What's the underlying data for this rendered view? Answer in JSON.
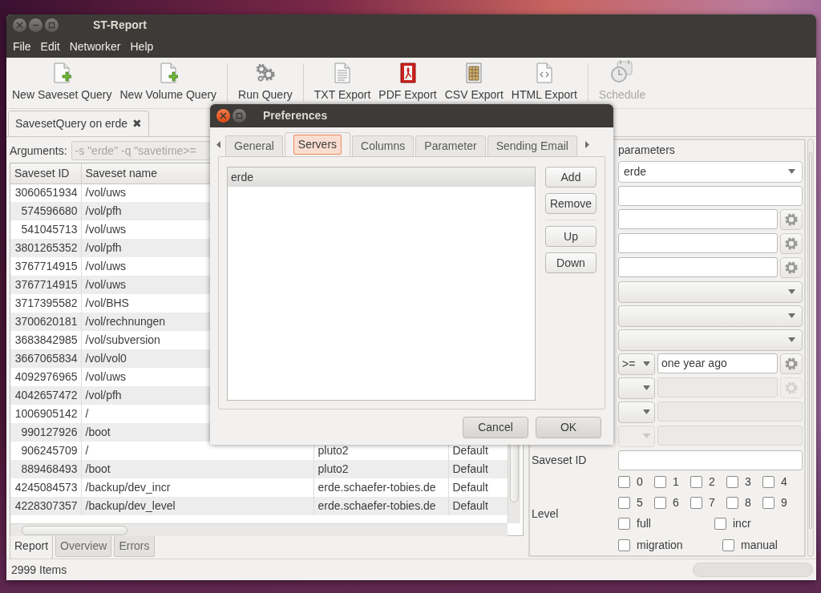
{
  "window": {
    "title": "ST-Report"
  },
  "menu": [
    "File",
    "Edit",
    "Networker",
    "Help"
  ],
  "toolbar_groups": [
    {
      "buttons": [
        {
          "label": "New Saveset Query",
          "disabled": false
        },
        {
          "label": "New Volume Query",
          "disabled": false
        }
      ]
    },
    {
      "buttons": [
        {
          "label": "Run Query",
          "disabled": false
        }
      ]
    },
    {
      "buttons": [
        {
          "label": "TXT Export",
          "disabled": false
        },
        {
          "label": "PDF Export",
          "disabled": false
        },
        {
          "label": "CSV Export",
          "disabled": false
        },
        {
          "label": "HTML Export",
          "disabled": false
        }
      ]
    },
    {
      "buttons": [
        {
          "label": "Schedule",
          "disabled": true
        }
      ]
    }
  ],
  "document_tabs": [
    {
      "label": "SavesetQuery on erde",
      "close": "✖",
      "selected": true
    }
  ],
  "arguments": {
    "label": "Arguments:",
    "value": "-s \"erde\" -q \"savetime>=",
    "disabled": true
  },
  "table": {
    "columns": [
      "Saveset ID",
      "Saveset name"
    ],
    "rows": [
      {
        "cells": [
          "3060651934",
          "/vol/uws"
        ]
      },
      {
        "cells": [
          "574596680",
          "/vol/pfh"
        ]
      },
      {
        "cells": [
          "541045713",
          "/vol/uws"
        ]
      },
      {
        "cells": [
          "3801265352",
          "/vol/pfh"
        ]
      },
      {
        "cells": [
          "3767714915",
          "/vol/uws"
        ]
      },
      {
        "cells": [
          "3767714915",
          "/vol/uws"
        ]
      },
      {
        "cells": [
          "3717395582",
          "/vol/BHS"
        ]
      },
      {
        "cells": [
          "3700620181",
          "/vol/rechnungen"
        ]
      },
      {
        "cells": [
          "3683842985",
          "/vol/subversion"
        ]
      },
      {
        "cells": [
          "3667065834",
          "/vol/vol0"
        ]
      },
      {
        "cells": [
          "4092976965",
          "/vol/uws"
        ]
      },
      {
        "cells": [
          "4042657472",
          "/vol/pfh"
        ]
      },
      {
        "cells": [
          "1006905142",
          "/"
        ]
      },
      {
        "cells": [
          "990127926",
          "/boot"
        ]
      },
      {
        "cells": [
          "906245709",
          "/",
          "pluto2",
          "Default"
        ]
      },
      {
        "cells": [
          "889468493",
          "/boot",
          "pluto2",
          "Default"
        ]
      },
      {
        "cells": [
          "4245084573",
          "/backup/dev_incr",
          "erde.schaefer-tobies.de",
          "Default"
        ]
      },
      {
        "cells": [
          "4228307357",
          "/backup/dev_level",
          "erde.schaefer-tobies.de",
          "Default"
        ]
      }
    ]
  },
  "bottom_tabs": [
    {
      "label": "Report",
      "selected": true
    },
    {
      "label": "Overview",
      "selected": false
    },
    {
      "label": "Errors",
      "selected": false
    }
  ],
  "status_bar": {
    "text": "2999 Items"
  },
  "query_panel": {
    "title": "parameters",
    "rows": [
      {
        "parts": [
          {
            "kind": "combo",
            "value": "erde",
            "disabled": false
          }
        ]
      },
      {
        "parts": [
          {
            "kind": "input",
            "disabled": false
          }
        ]
      },
      {
        "parts": [
          {
            "kind": "input",
            "disabled": false
          },
          {
            "kind": "gear",
            "disabled": false
          }
        ]
      },
      {
        "parts": [
          {
            "kind": "input",
            "disabled": false
          },
          {
            "kind": "gear",
            "disabled": false
          }
        ]
      },
      {
        "parts": [
          {
            "kind": "input",
            "disabled": false
          },
          {
            "kind": "gear",
            "disabled": false
          }
        ]
      },
      {
        "parts": [
          {
            "kind": "combo",
            "disabled": false
          }
        ]
      },
      {
        "parts": [
          {
            "kind": "combo",
            "disabled": false
          }
        ]
      },
      {
        "parts": [
          {
            "kind": "combo",
            "disabled": false
          }
        ]
      },
      {
        "parts": [
          {
            "kind": "combo",
            "value": ">=",
            "disabled": false
          },
          {
            "kind": "input",
            "value": "one year ago",
            "disabled": false
          },
          {
            "kind": "gear",
            "disabled": false
          }
        ]
      },
      {
        "parts": [
          {
            "kind": "combo",
            "disabled": false
          },
          {
            "kind": "input",
            "disabled": true
          },
          {
            "kind": "gear",
            "disabled": true
          }
        ]
      },
      {
        "parts": [
          {
            "kind": "combo",
            "disabled": false
          },
          {
            "kind": "input",
            "disabled": true
          }
        ]
      },
      {
        "parts": [
          {
            "kind": "combo",
            "disabled": true
          },
          {
            "kind": "input",
            "disabled": true
          }
        ]
      },
      {
        "label": "Saveset ID",
        "parts": [
          {
            "kind": "input",
            "disabled": false
          }
        ]
      }
    ],
    "level": {
      "label": "Level",
      "digits": [
        {
          "label": "0",
          "checked": false
        },
        {
          "label": "1",
          "checked": false
        },
        {
          "label": "2",
          "checked": false
        },
        {
          "label": "3",
          "checked": false
        },
        {
          "label": "4",
          "checked": false
        },
        {
          "label": "5",
          "checked": false
        },
        {
          "label": "6",
          "checked": false
        },
        {
          "label": "7",
          "checked": false
        },
        {
          "label": "8",
          "checked": false
        },
        {
          "label": "9",
          "checked": false
        }
      ],
      "types": [
        {
          "label": "full",
          "checked": false
        },
        {
          "label": "incr",
          "checked": false
        },
        {
          "label": "migration",
          "checked": false
        },
        {
          "label": "manual",
          "checked": false
        }
      ]
    }
  },
  "dialog": {
    "title": "Preferences",
    "tabs": [
      {
        "label": "General",
        "selected": false
      },
      {
        "label": "Servers",
        "selected": true
      },
      {
        "label": "Columns",
        "selected": false
      },
      {
        "label": "Parameter",
        "selected": false
      },
      {
        "label": "Sending Email",
        "selected": false
      }
    ],
    "servers": [
      {
        "label": "erde",
        "selected": true
      }
    ],
    "side_button_groups": [
      [
        "Add",
        "Remove"
      ],
      [
        "Up",
        "Down"
      ]
    ],
    "buttons": [
      "Cancel",
      "OK"
    ]
  }
}
